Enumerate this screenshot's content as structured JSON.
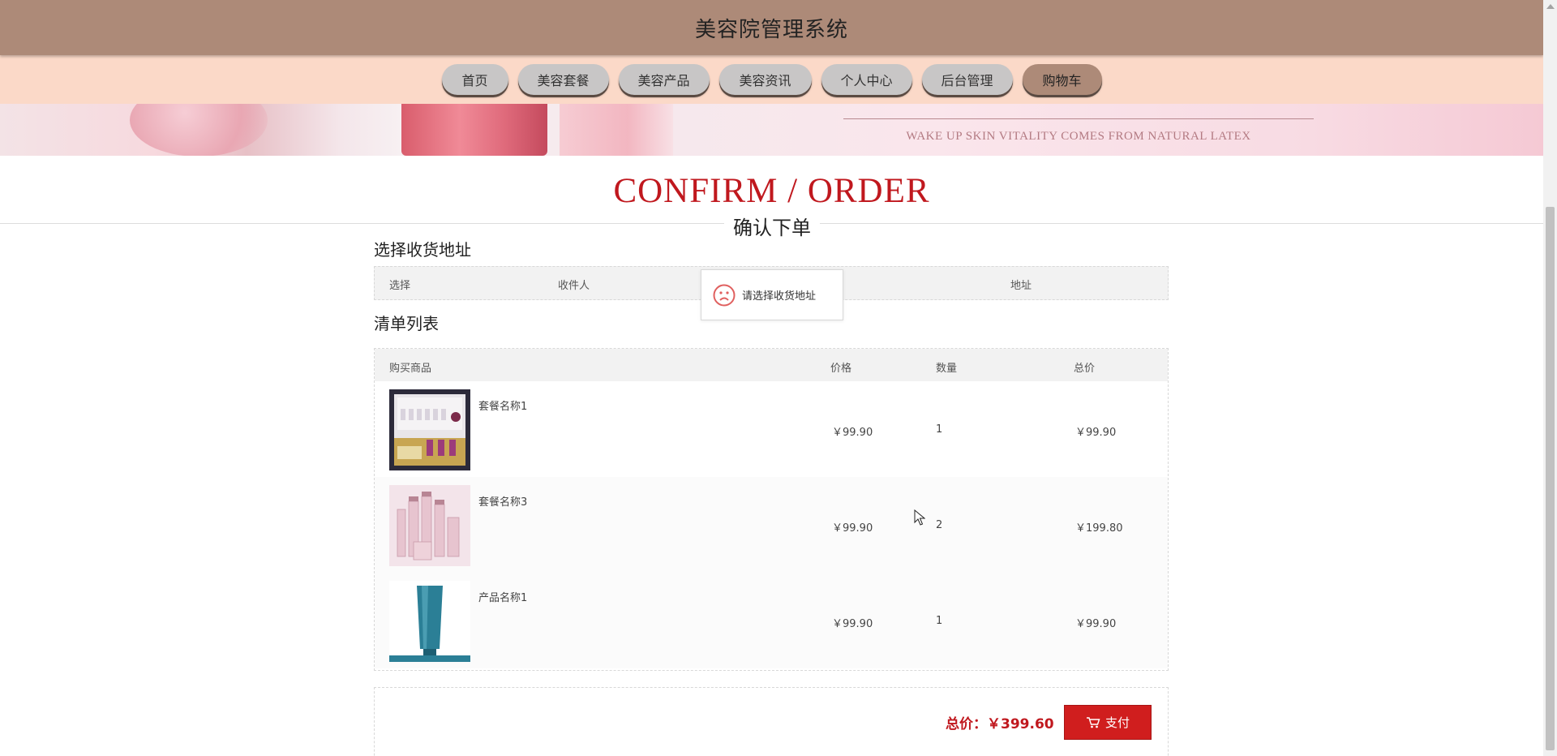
{
  "header": {
    "title": "美容院管理系统"
  },
  "nav": {
    "items": [
      {
        "label": "首页",
        "active": false
      },
      {
        "label": "美容套餐",
        "active": false
      },
      {
        "label": "美容产品",
        "active": false
      },
      {
        "label": "美容资讯",
        "active": false
      },
      {
        "label": "个人中心",
        "active": false
      },
      {
        "label": "后台管理",
        "active": false
      },
      {
        "label": "购物车",
        "active": true
      }
    ]
  },
  "banner": {
    "slogan": "WAKE UP SKIN VITALITY COMES FROM NATURAL LATEX"
  },
  "section": {
    "title_en": "CONFIRM / ORDER",
    "title_cn": "确认下单"
  },
  "address": {
    "title": "选择收货地址",
    "columns": [
      "选择",
      "收件人",
      "地址"
    ]
  },
  "toast": {
    "message": "请选择收货地址",
    "icon": "sad-face-icon"
  },
  "list": {
    "title": "清单列表",
    "columns": [
      "购买商品",
      "价格",
      "数量",
      "总价"
    ],
    "rows": [
      {
        "name": "套餐名称1",
        "price": "￥99.90",
        "qty": "1",
        "total": "￥99.90"
      },
      {
        "name": "套餐名称3",
        "price": "￥99.90",
        "qty": "2",
        "total": "￥199.80"
      },
      {
        "name": "产品名称1",
        "price": "￥99.90",
        "qty": "1",
        "total": "￥99.90"
      }
    ]
  },
  "summary": {
    "total_label": "总价：",
    "total_value": "￥399.60",
    "pay_label": "支付"
  },
  "colors": {
    "accent": "#c0181e",
    "header": "#ad8a78",
    "nav_bg": "#fbd9c8",
    "pay_button": "#d01e1e"
  }
}
